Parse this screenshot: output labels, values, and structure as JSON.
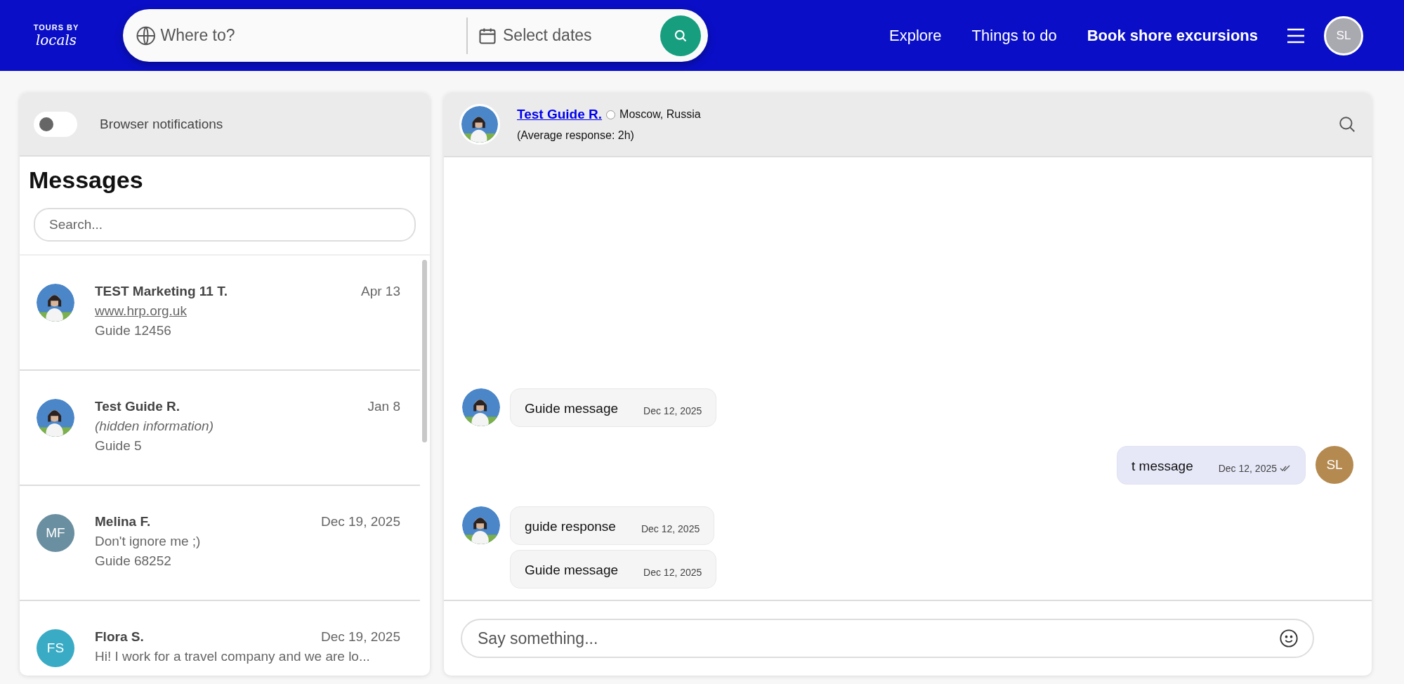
{
  "header": {
    "logo": {
      "line1": "TOURS BY",
      "line2": "locals"
    },
    "search": {
      "destination_placeholder": "Where to?",
      "dates_placeholder": "Select dates"
    },
    "nav": [
      {
        "label": "Explore",
        "emphasized": false
      },
      {
        "label": "Things to do",
        "emphasized": false
      },
      {
        "label": "Book shore excursions",
        "emphasized": true
      }
    ],
    "user_initials": "SL"
  },
  "sidebar": {
    "notifications": {
      "label": "Browser notifications",
      "on": false
    },
    "title": "Messages",
    "search_placeholder": "Search...",
    "conversations": [
      {
        "name": "TEST Marketing 11 T.",
        "date": "Apr 13",
        "preview": "www.hrp.org.uk",
        "kind": "link",
        "subtitle": "Guide 12456",
        "avatar": {
          "kind": "photo"
        }
      },
      {
        "name": "Test Guide R.",
        "date": "Jan 8",
        "preview": "(hidden information)",
        "kind": "hidden",
        "subtitle": "Guide 5",
        "avatar": {
          "kind": "photo"
        }
      },
      {
        "name": "Melina F.",
        "date": "Dec 19, 2025",
        "preview": "Don't ignore me ;)",
        "kind": "text",
        "subtitle": "Guide 68252",
        "avatar": {
          "kind": "initials",
          "initials": "MF",
          "color": "#6a8fa0"
        }
      },
      {
        "name": "Flora S.",
        "date": "Dec 19, 2025",
        "preview": "Hi! I work for a travel company and we are lo...",
        "kind": "text",
        "avatar": {
          "kind": "initials",
          "initials": "FS",
          "color": "#3aabc4"
        }
      }
    ]
  },
  "chat": {
    "contact": {
      "name": "Test Guide R.",
      "online": false,
      "location": "Moscow, Russia",
      "response": "(Average response: 2h)"
    },
    "messages": [
      {
        "kind": "incoming",
        "text": "Guide message",
        "date": "Dec 12, 2025",
        "show_avatar": true
      },
      {
        "kind": "outgoing",
        "text": "t message",
        "date": "Dec 12, 2025",
        "read": true,
        "show_avatar": true,
        "initials": "SL"
      },
      {
        "kind": "incoming",
        "text": "guide response",
        "date": "Dec 12, 2025",
        "show_avatar": true
      },
      {
        "kind": "incoming",
        "text": "Guide message",
        "date": "Dec 12, 2025",
        "show_avatar": false
      }
    ],
    "composer_placeholder": "Say something..."
  }
}
